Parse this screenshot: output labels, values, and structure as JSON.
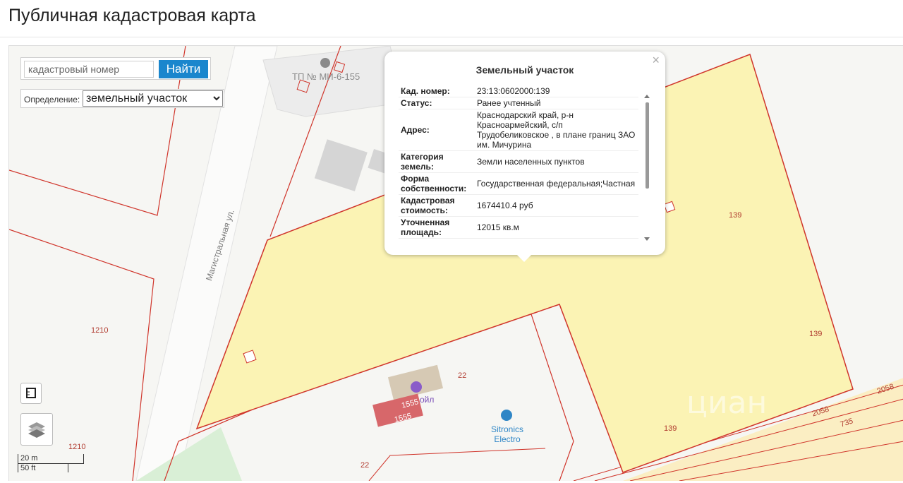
{
  "page": {
    "title": "Публичная кадастровая карта"
  },
  "search": {
    "placeholder": "кадастровый номер",
    "button_label": "Найти"
  },
  "definition": {
    "label": "Определение:",
    "selected": "земельный участок"
  },
  "popup": {
    "title": "Земельный участок",
    "close": "×",
    "rows": [
      {
        "key": "Кад. номер:",
        "value": "23:13:0602000:139"
      },
      {
        "key": "Статус:",
        "value": "Ранее учтенный"
      },
      {
        "key": "Адрес:",
        "value": "Краснодарский край, р-н Красноармейский, с/п Трудобеликовское , в плане границ ЗАО им. Мичурина"
      },
      {
        "key": "Категория земель:",
        "value": "Земли населенных пунктов"
      },
      {
        "key": "Форма собственности:",
        "value": "Государственная федеральная;Частная"
      },
      {
        "key": "Кадастровая стоимость:",
        "value": "1674410.4 руб"
      },
      {
        "key": "Уточненная площадь:",
        "value": "12015 кв.м"
      }
    ]
  },
  "map": {
    "street": "Магистральная ул.",
    "tp": "ТП № МИ-6-155",
    "poi": [
      "Sitronics",
      "Electro"
    ],
    "poi2": "ойл",
    "parcel_labels": [
      "139",
      "139",
      "139",
      "1210",
      "1210",
      "22",
      "22",
      "1555",
      "1555",
      "2058",
      "2058",
      "735"
    ],
    "watermark": "циан"
  },
  "scale": {
    "metric": "20 m",
    "imperial": "50 ft"
  },
  "colors": {
    "parcel_fill": "#fbf3b4",
    "parcel_stroke": "#d0352b",
    "accent": "#1a86cd"
  }
}
